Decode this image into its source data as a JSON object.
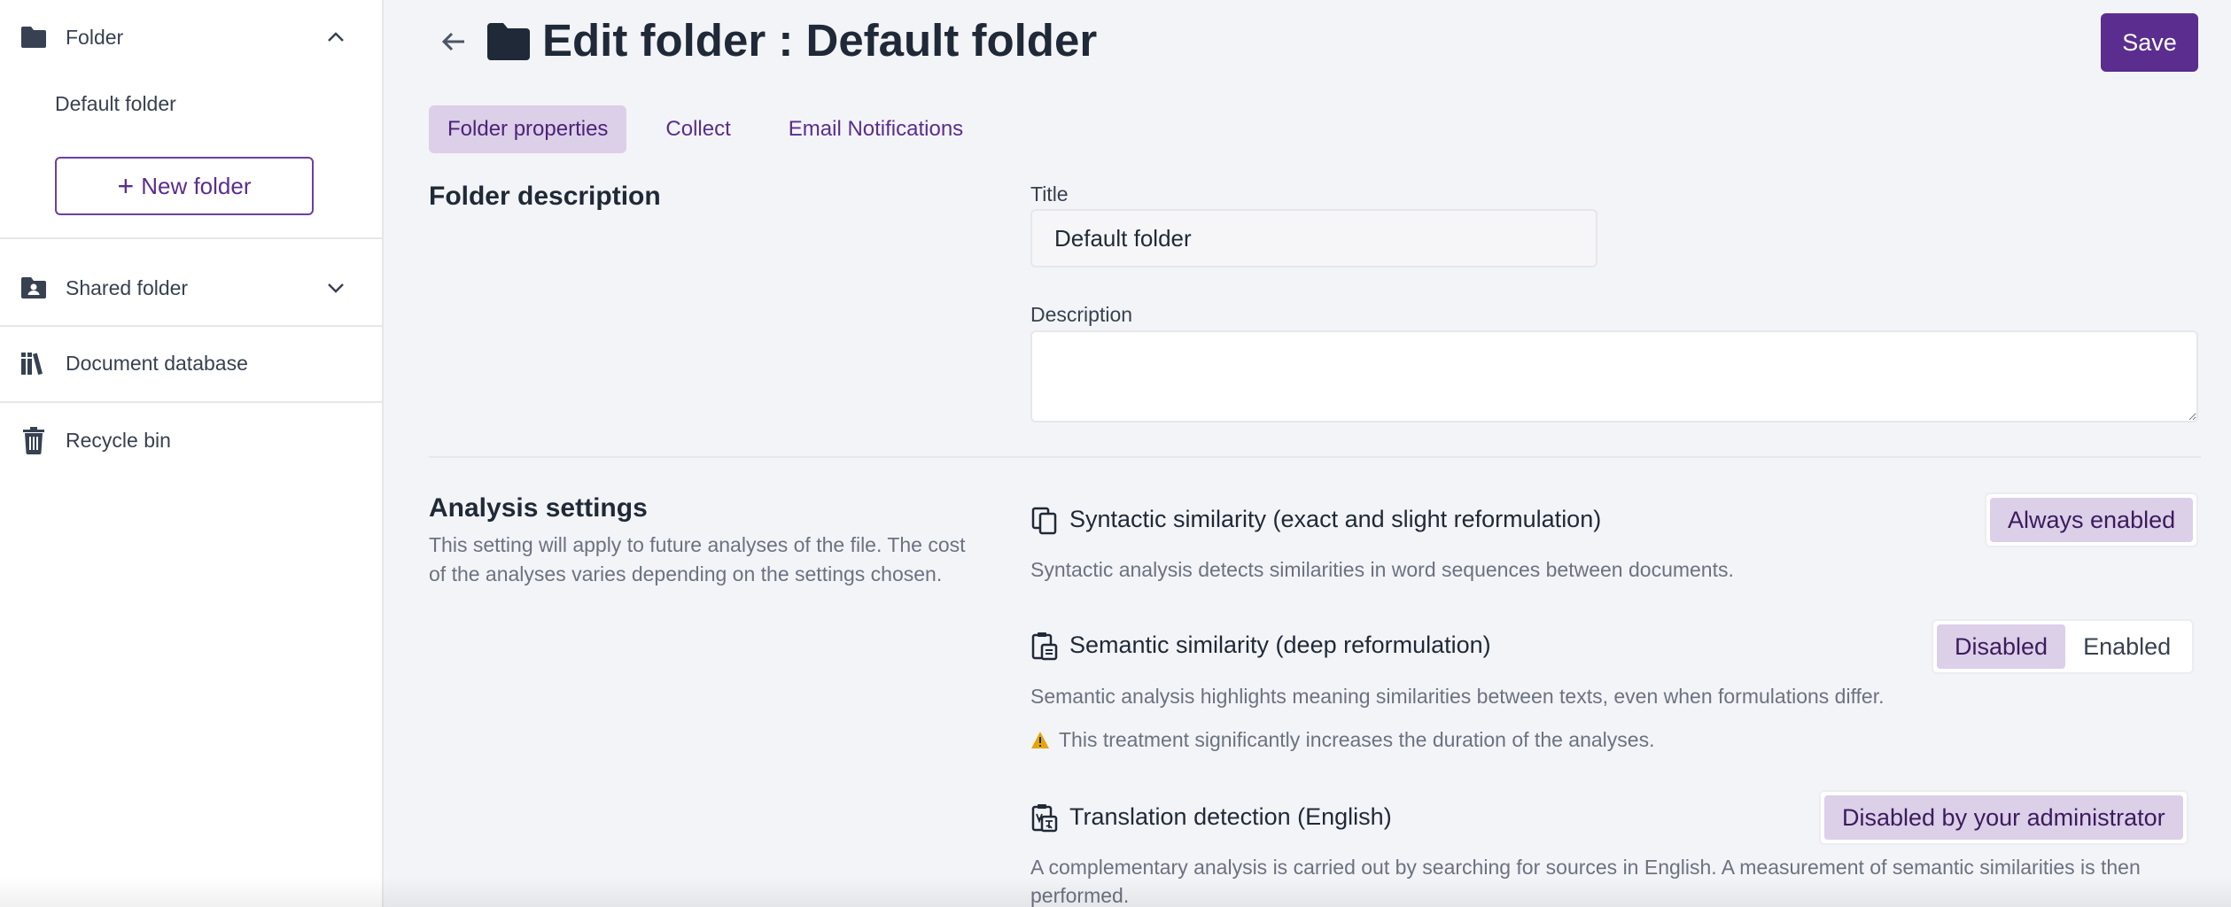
{
  "sidebar": {
    "folder_label": "Folder",
    "default_folder": "Default folder",
    "new_folder_label": "New folder",
    "shared_folder_label": "Shared folder",
    "document_database_label": "Document database",
    "recycle_bin_label": "Recycle bin"
  },
  "header": {
    "title": "Edit folder : Default folder",
    "save_label": "Save"
  },
  "tabs": [
    {
      "label": "Folder properties",
      "active": true
    },
    {
      "label": "Collect",
      "active": false
    },
    {
      "label": "Email Notifications",
      "active": false
    }
  ],
  "folder_description": {
    "section_title": "Folder description",
    "title_label": "Title",
    "title_value": "Default folder",
    "description_label": "Description",
    "description_value": ""
  },
  "analysis": {
    "section_title": "Analysis settings",
    "section_sub": "This setting will apply to future analyses of the file. The cost of the analyses varies depending on the settings chosen.",
    "syntactic": {
      "title": "Syntactic similarity (exact and slight reformulation)",
      "desc": "Syntactic analysis detects similarities in word sequences between documents.",
      "status": "Always enabled"
    },
    "semantic": {
      "title": "Semantic similarity (deep reformulation)",
      "desc": "Semantic analysis highlights meaning similarities between texts, even when formulations differ.",
      "warning": "This treatment significantly increases the duration of the analyses.",
      "option_disabled": "Disabled",
      "option_enabled": "Enabled",
      "selected": "Disabled"
    },
    "translation": {
      "title": "Translation detection (English)",
      "desc": "A complementary analysis is carried out by searching for sources in English. A measurement of semantic similarities is then performed.",
      "status": "Disabled by your administrator"
    }
  },
  "colors": {
    "accent": "#5b2d8e",
    "accent_light": "#dccfe8",
    "warning": "#e5a50a"
  }
}
